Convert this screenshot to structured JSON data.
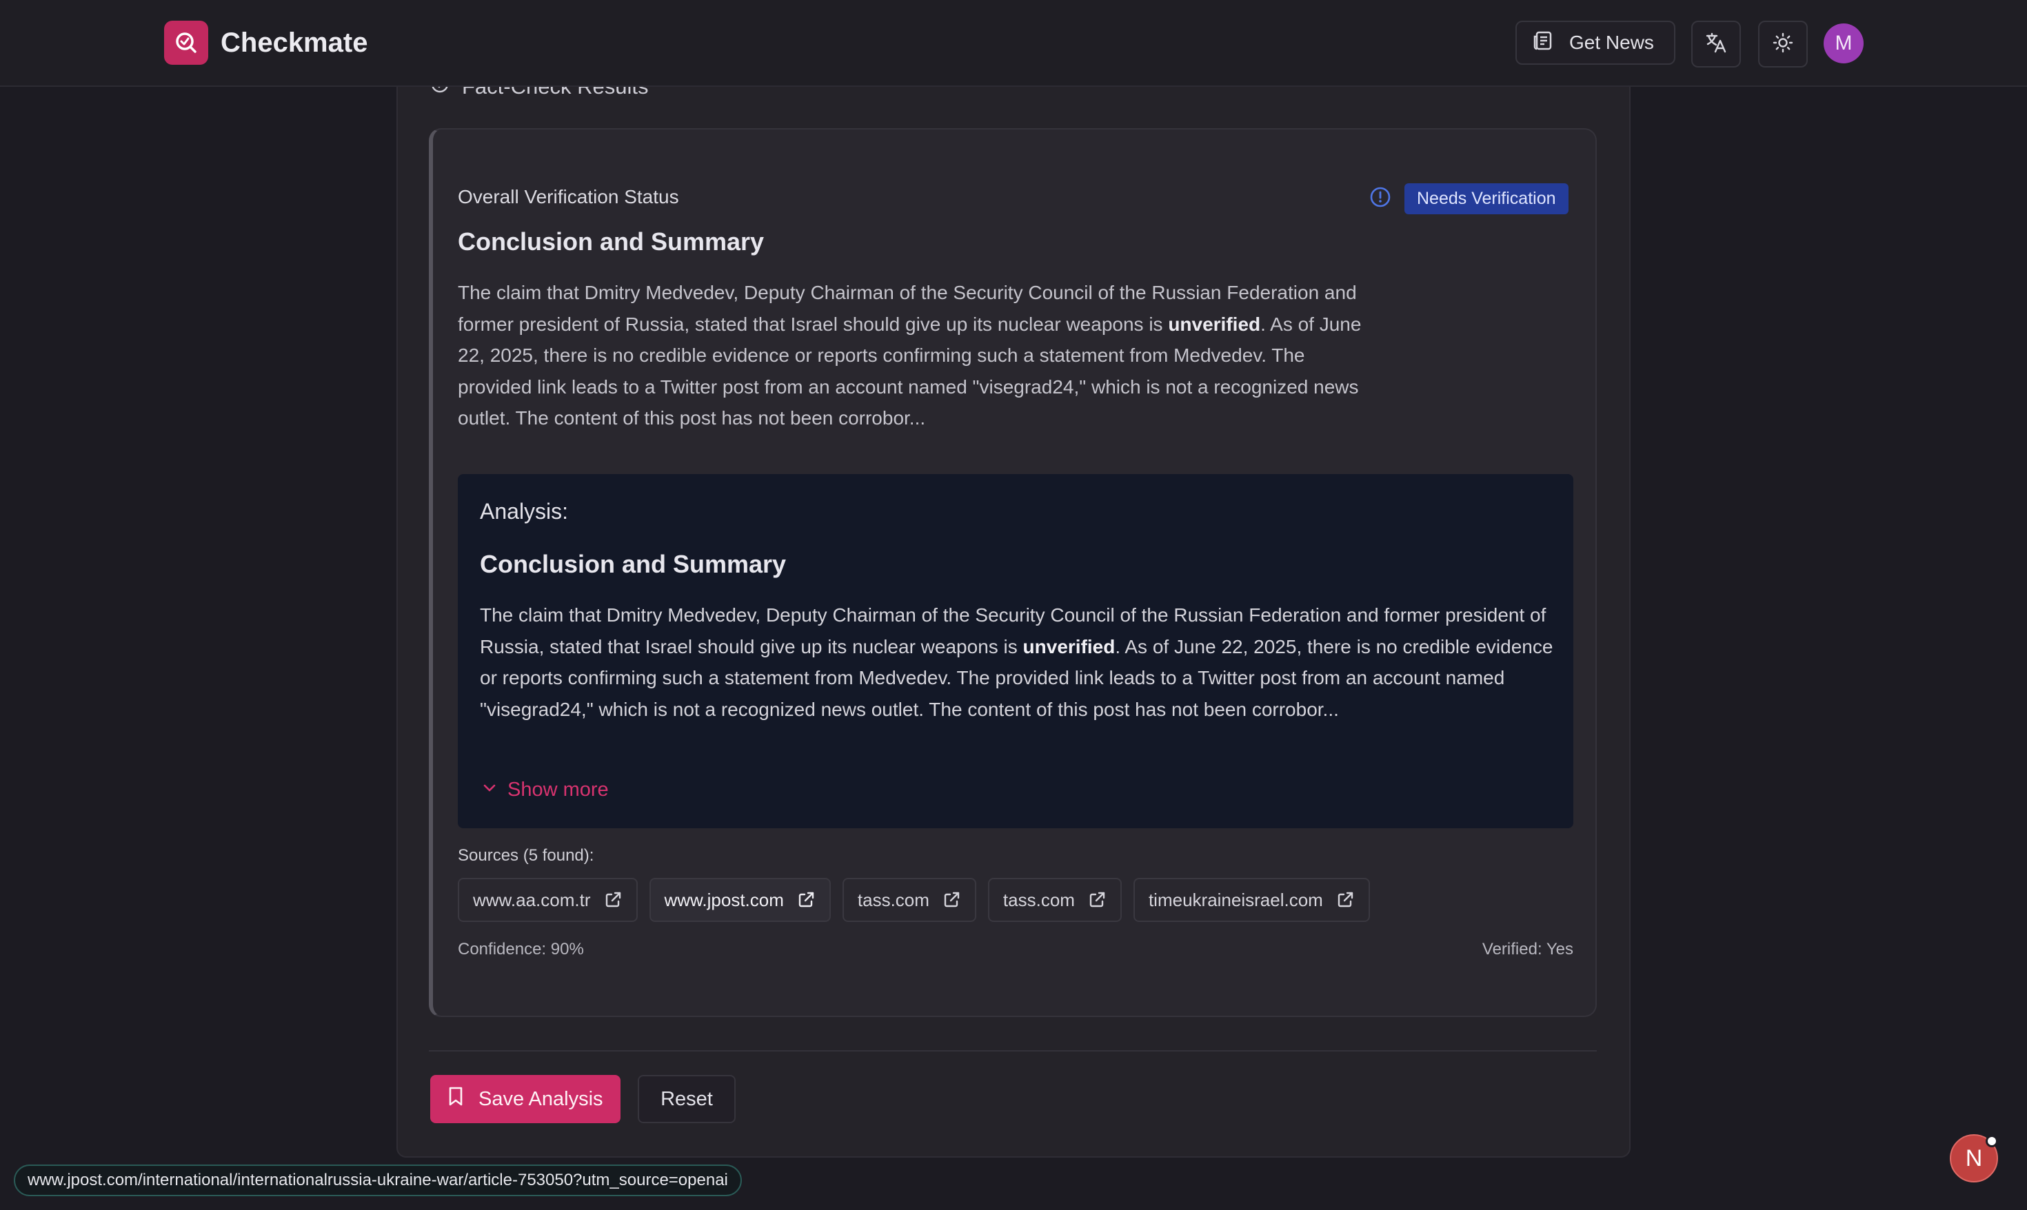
{
  "header": {
    "app_name": "Checkmate",
    "get_news_label": "Get News",
    "avatar_initial": "M",
    "icons": {
      "logo": "search-check-icon",
      "news": "newspaper-icon",
      "language": "translate-icon",
      "theme": "sun-icon"
    }
  },
  "results": {
    "section_title": "Fact-Check Results",
    "overall_label": "Overall Verification Status",
    "status_badge": "Needs Verification",
    "summary_heading": "Conclusion and Summary",
    "summary_text": {
      "before": "The claim that Dmitry Medvedev, Deputy Chairman of the Security Council of the Russian Federation and former president of Russia, stated that Israel should give up its nuclear weapons is ",
      "bold": "unverified",
      "after": ". As of June 22, 2025, there is no credible evidence or reports confirming such a statement from Medvedev. The provided link leads to a Twitter post from an account named \"visegrad24,\" which is not a recognized news outlet. The content of this post has not been corrobor..."
    },
    "analysis": {
      "label": "Analysis:",
      "heading": "Conclusion and Summary",
      "text_before": "The claim that Dmitry Medvedev, Deputy Chairman of the Security Council of the Russian Federation and former president of Russia, stated that Israel should give up its nuclear weapons is ",
      "text_bold": "unverified",
      "text_after": ". As of June 22, 2025, there is no credible evidence or reports confirming such a statement from Medvedev. The provided link leads to a Twitter post from an account named \"visegrad24,\" which is not a recognized news outlet. The content of this post has not been corrobor...",
      "show_more": "Show more"
    },
    "sources_label": "Sources (5 found):",
    "sources": [
      {
        "label": "www.aa.com.tr"
      },
      {
        "label": "www.jpost.com"
      },
      {
        "label": "tass.com"
      },
      {
        "label": "tass.com"
      },
      {
        "label": "timeukraineisrael.com"
      }
    ],
    "confidence": "Confidence: 90%",
    "verified": "Verified: Yes"
  },
  "actions": {
    "save_label": "Save Analysis",
    "reset_label": "Reset"
  },
  "status_url": "www.jpost.com/international/internationalrussia-ukraine-war/article-753050?utm_source=openai",
  "fab_initial": "N",
  "colors": {
    "accent": "#cc2c66",
    "badge_bg": "#243c9a",
    "analysis_bg": "#131827",
    "background": "#1c1b22"
  }
}
